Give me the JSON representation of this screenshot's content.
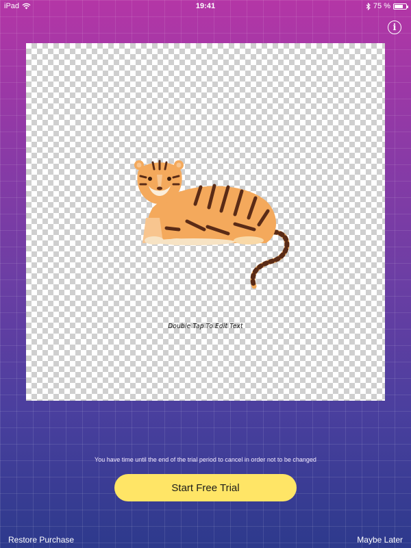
{
  "status_bar": {
    "device": "iPad",
    "time": "19:41",
    "battery_text": "75 %",
    "battery_level": 0.75,
    "wifi_icon": "wifi-icon",
    "bluetooth_icon": "bluetooth-icon"
  },
  "info_button": {
    "icon": "info-icon",
    "glyph": "i"
  },
  "canvas": {
    "placeholder_text": "Double Tap To Edit Text",
    "image": "tiger-illustration"
  },
  "footer": {
    "disclaimer": "You have time until the end of the trial period to cancel in order not to be changed",
    "cta_label": "Start Free Trial",
    "restore_label": "Restore Purchase",
    "later_label": "Maybe Later"
  },
  "colors": {
    "cta_background": "#ffe566",
    "gradient_top": "#b436a6",
    "gradient_bottom": "#2d3a8c"
  }
}
